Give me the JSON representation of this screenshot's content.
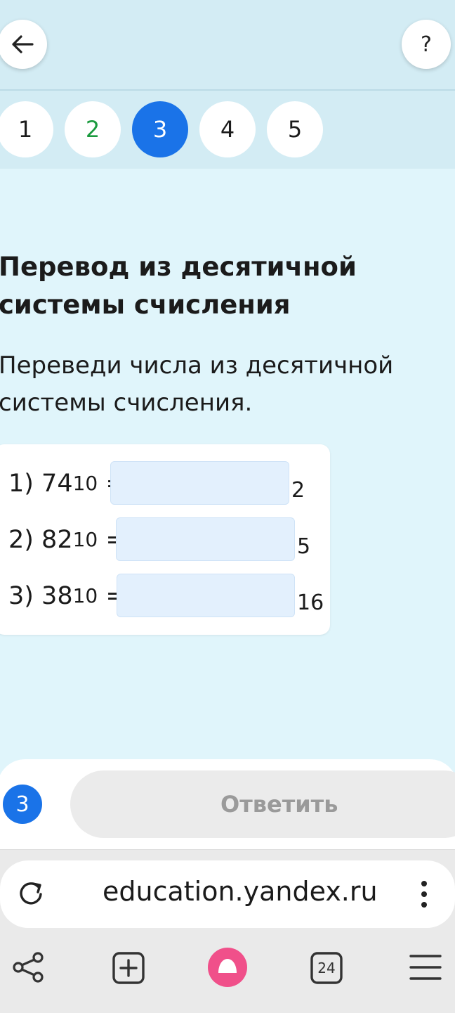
{
  "header": {
    "back_icon": "arrow-left-icon",
    "help_label": "?"
  },
  "tabs": [
    {
      "label": "1",
      "state": "default"
    },
    {
      "label": "2",
      "state": "done"
    },
    {
      "label": "3",
      "state": "active"
    },
    {
      "label": "4",
      "state": "default"
    },
    {
      "label": "5",
      "state": "default"
    }
  ],
  "task": {
    "title": "Перевод из десятичной системы счисления",
    "instruction": "Переведи числа из десятичной системы счисления."
  },
  "exercises": [
    {
      "prefix": "1) 74",
      "source_base": "10",
      "equals": "=",
      "value": "",
      "target_base": "2"
    },
    {
      "prefix": "2) 82",
      "source_base": "10",
      "equals": "=",
      "value": "",
      "target_base": "5"
    },
    {
      "prefix": "3) 38",
      "source_base": "10",
      "equals": "=",
      "value": "",
      "target_base": "16"
    }
  ],
  "footer": {
    "task_number": "3",
    "answer_label": "Ответить"
  },
  "browser": {
    "url": "education.yandex.ru",
    "tabs_count": "24",
    "icons": [
      "share-icon",
      "new-tab-icon",
      "alice-icon",
      "tabs-icon",
      "menu-icon"
    ]
  },
  "colors": {
    "accent": "#1a73e8",
    "done": "#1a9a3e",
    "page_bg": "#e0f5fb",
    "header_bg": "#d3ecf4",
    "input_bg": "#e3f0fd",
    "alice": "#f0508a"
  }
}
